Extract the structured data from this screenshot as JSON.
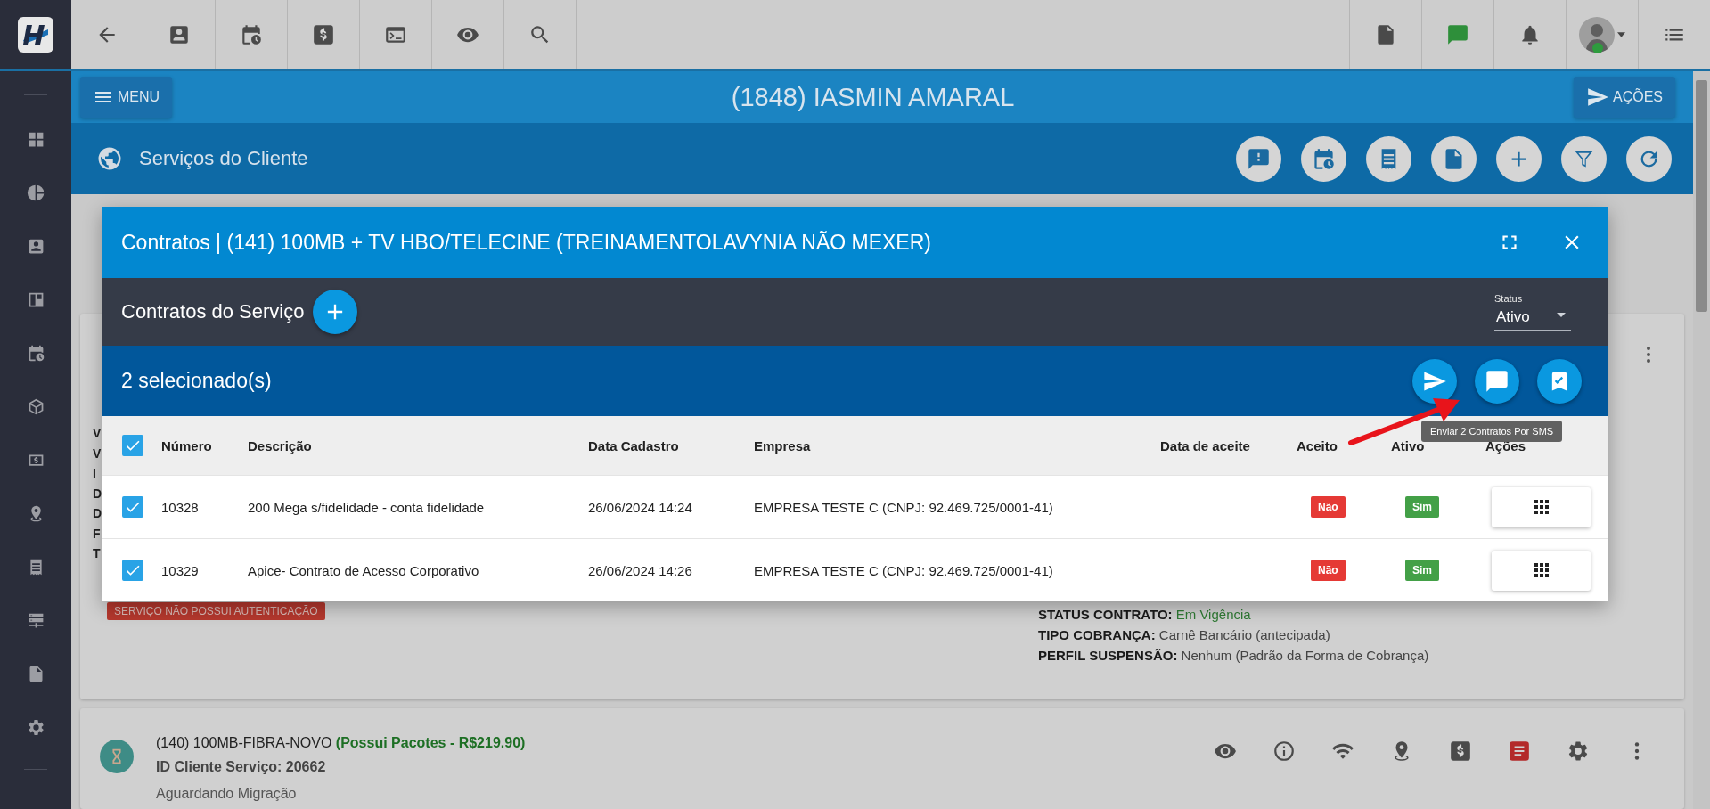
{
  "header": {
    "menu_button": "MENU",
    "client_title": "(1848) IASMIN AMARAL",
    "actions_button": "AÇÕES"
  },
  "section": {
    "title": "Serviços do Cliente"
  },
  "background": {
    "service_card": {
      "label_fragments": [
        "V",
        "V",
        "I",
        "D",
        "D",
        "F",
        "T"
      ],
      "badge": "SERVIÇO NÃO POSSUI AUTENTICAÇÃO",
      "details": [
        {
          "label": "STATUS CONTRATO:",
          "value": "Em Vigência",
          "kind": "success"
        },
        {
          "label": "TIPO COBRANÇA:",
          "value": "Carnê Bancário (antecipada)",
          "kind": "plain"
        },
        {
          "label": "PERFIL SUSPENSÃO:",
          "value": "Nenhum (Padrão da Forma de Cobrança)",
          "kind": "plain"
        }
      ]
    },
    "next_service": {
      "title": "(140) 100MB-FIBRA-NOVO",
      "packages": "(Possui Pacotes - R$219.90)",
      "id_line": "ID Cliente Serviço: 20662",
      "status": "Aguardando Migração"
    }
  },
  "modal": {
    "title": "Contratos | (141) 100MB + TV HBO/TELECINE (TREINAMENTOLAVYNIA NÃO MEXER)",
    "section_title": "Contratos do Serviço",
    "status_filter": {
      "label": "Status",
      "value": "Ativo"
    },
    "selection_count": "2 selecionado(s)",
    "tooltip": "Enviar 2 Contratos Por SMS",
    "all_checked": true,
    "columns": [
      "Número",
      "Descrição",
      "Data Cadastro",
      "Empresa",
      "Data de aceite",
      "Aceito",
      "Ativo",
      "Ações"
    ],
    "rows": [
      {
        "checked": true,
        "numero": "10328",
        "descricao": "200 Mega s/fidelidade - conta fidelidade",
        "data_cadastro": "26/06/2024 14:24",
        "empresa": "EMPRESA TESTE C (CNPJ: 92.469.725/0001-41)",
        "aceito": {
          "text": "Não",
          "kind": "no"
        },
        "ativo": {
          "text": "Sim",
          "kind": "yes"
        }
      },
      {
        "checked": true,
        "numero": "10329",
        "descricao": "Apice- Contrato de Acesso Corporativo",
        "data_cadastro": "26/06/2024 14:26",
        "empresa": "EMPRESA TESTE C (CNPJ: 92.469.725/0001-41)",
        "aceito": {
          "text": "Não",
          "kind": "no"
        },
        "ativo": {
          "text": "Sim",
          "kind": "yes"
        }
      }
    ]
  }
}
